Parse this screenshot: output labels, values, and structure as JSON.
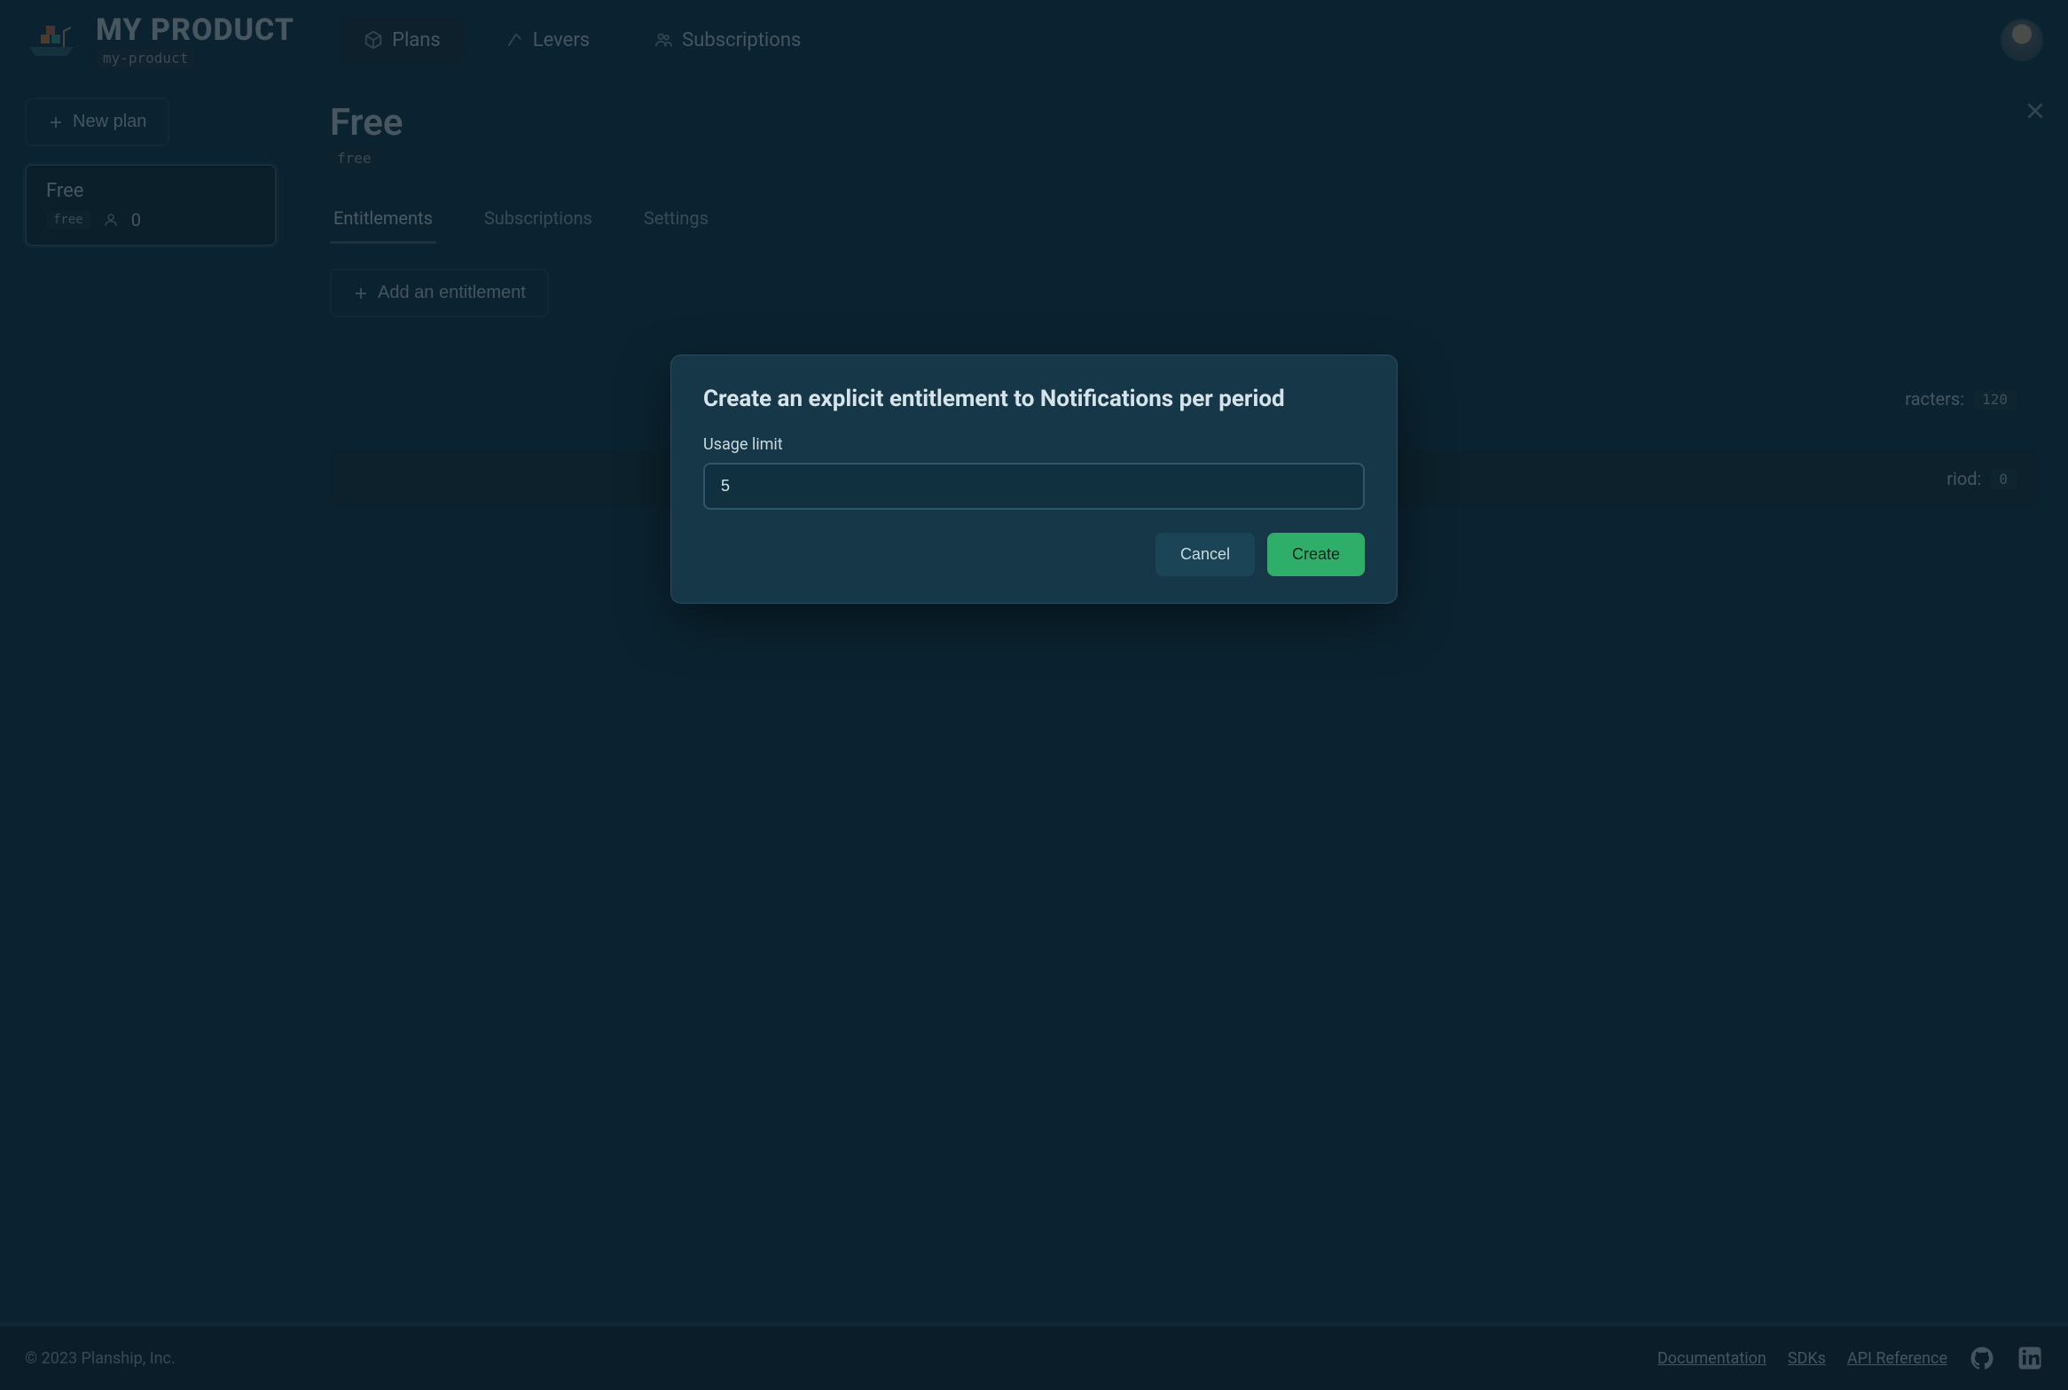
{
  "header": {
    "product_name": "MY PRODUCT",
    "product_slug": "my-product",
    "nav": {
      "plans": "Plans",
      "levers": "Levers",
      "subscriptions": "Subscriptions"
    }
  },
  "sidebar": {
    "new_plan_label": "New plan",
    "plan_card": {
      "name": "Free",
      "slug": "free",
      "subscriber_count": "0"
    }
  },
  "content": {
    "title": "Free",
    "slug": "free",
    "tabs": {
      "entitlements": "Entitlements",
      "subscriptions": "Subscriptions",
      "settings": "Settings"
    },
    "add_entitlement_label": "Add an entitlement",
    "rows": [
      {
        "label_suffix": "racters:",
        "value": "120"
      },
      {
        "label_suffix": "riod:",
        "value": "0"
      }
    ]
  },
  "modal": {
    "title": "Create an explicit entitlement to Notifications per period",
    "field_label": "Usage limit",
    "field_value": "5",
    "cancel_label": "Cancel",
    "create_label": "Create"
  },
  "footer": {
    "copyright": "© 2023 Planship, Inc.",
    "links": {
      "documentation": "Documentation",
      "sdks": "SDKs",
      "api_reference": "API Reference"
    }
  }
}
